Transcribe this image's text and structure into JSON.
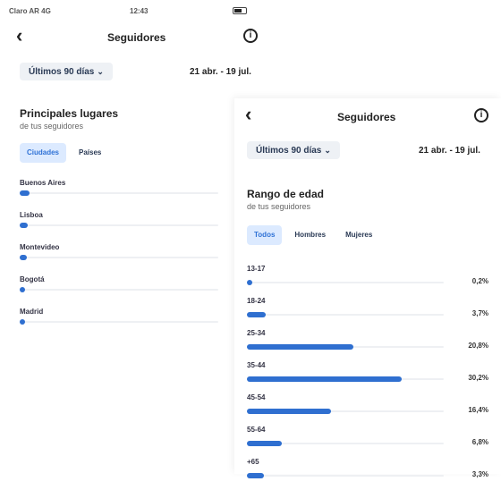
{
  "colors": {
    "accent": "#2f6fd0",
    "active_bg": "#dceaff",
    "dropdown_bg": "#eef1f5",
    "track": "#eef0f3"
  },
  "status_bar": {
    "carrier": "Claro AR 4G",
    "time": "12:43"
  },
  "left": {
    "title": "Seguidores",
    "range_label": "Últimos 90 días",
    "date_range": "21 abr. - 19 jul.",
    "section_title": "Principales lugares",
    "section_subtitle": "de tus seguidores",
    "tabs": [
      {
        "label": "Ciudades",
        "active": true
      },
      {
        "label": "Países",
        "active": false
      }
    ],
    "rows": [
      {
        "label": "Buenos Aires",
        "value": 0.05
      },
      {
        "label": "Lisboa",
        "value": 0.04
      },
      {
        "label": "Montevideo",
        "value": 0.035
      },
      {
        "label": "Bogotá",
        "value": 0.02
      },
      {
        "label": "Madrid",
        "value": 0.015
      }
    ]
  },
  "right": {
    "title": "Seguidores",
    "range_label": "Últimos 90 días",
    "date_range": "21 abr. - 19 jul.",
    "section_title": "Rango de edad",
    "section_subtitle": "de tus seguidores",
    "tabs": [
      {
        "label": "Todos",
        "active": true
      },
      {
        "label": "Hombres",
        "active": false
      },
      {
        "label": "Mujeres",
        "active": false
      }
    ],
    "rows": [
      {
        "label": "13-17",
        "value": 0.2,
        "text": "0,2%"
      },
      {
        "label": "18-24",
        "value": 3.7,
        "text": "3,7%"
      },
      {
        "label": "25-34",
        "value": 20.8,
        "text": "20,8%"
      },
      {
        "label": "35-44",
        "value": 30.2,
        "text": "30,2%"
      },
      {
        "label": "45-54",
        "value": 16.4,
        "text": "16,4%"
      },
      {
        "label": "55-64",
        "value": 6.8,
        "text": "6,8%"
      },
      {
        "label": "+65",
        "value": 3.3,
        "text": "3,3%"
      }
    ]
  }
}
